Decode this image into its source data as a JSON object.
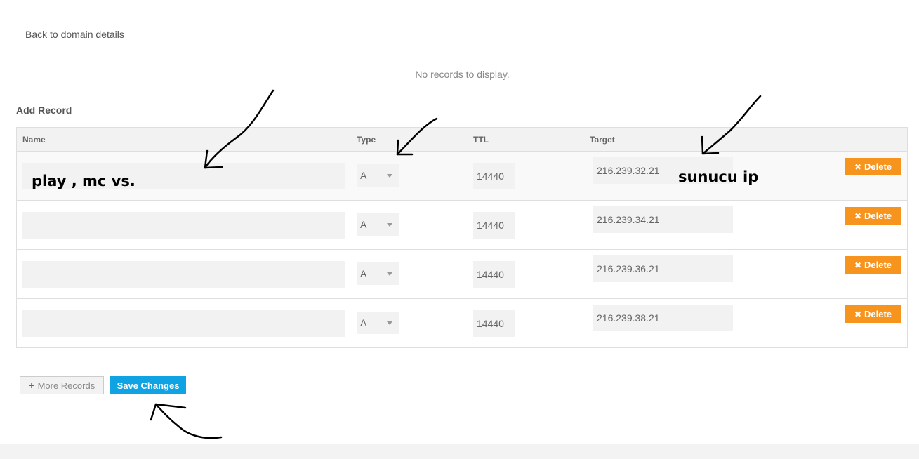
{
  "back_link": "Back to domain details",
  "empty_message": "No records to display.",
  "section_title": "Add Record",
  "columns": {
    "name": "Name",
    "type": "Type",
    "ttl": "TTL",
    "target": "Target"
  },
  "records": [
    {
      "name": "",
      "type": "A",
      "ttl": "14440",
      "target": "216.239.32.21",
      "delete_label": "Delete"
    },
    {
      "name": "",
      "type": "A",
      "ttl": "14440",
      "target": "216.239.34.21",
      "delete_label": "Delete"
    },
    {
      "name": "",
      "type": "A",
      "ttl": "14440",
      "target": "216.239.36.21",
      "delete_label": "Delete"
    },
    {
      "name": "",
      "type": "A",
      "ttl": "14440",
      "target": "216.239.38.21",
      "delete_label": "Delete"
    }
  ],
  "buttons": {
    "more_records": "More Records",
    "save_changes": "Save Changes"
  },
  "annotations": {
    "name_note": "play , mc vs.",
    "target_note": "sunucu ip"
  },
  "colors": {
    "delete": "#f7941d",
    "save": "#0fa3e4",
    "annotation_ink": "#000000"
  }
}
